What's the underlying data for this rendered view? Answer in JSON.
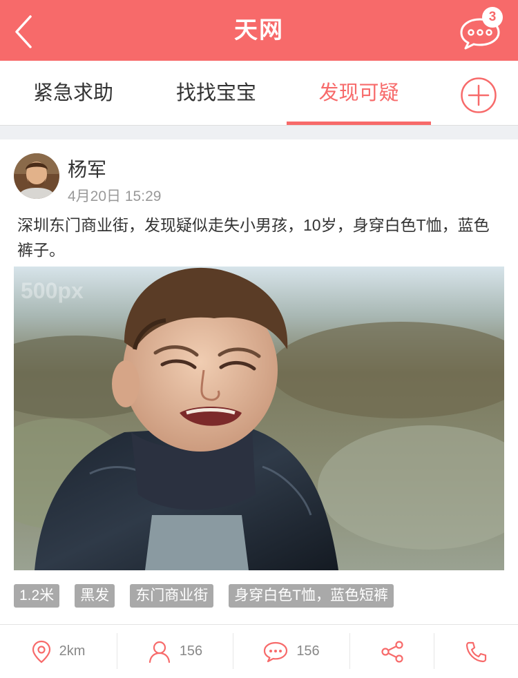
{
  "theme": {
    "accent": "#f76a6a",
    "tag_bg": "#a9a9a9"
  },
  "header": {
    "title": "天网",
    "back_icon": "chevron-left-icon",
    "message_icon": "chat-bubble-icon",
    "message_badge": "3"
  },
  "tabs": [
    {
      "label": "紧急求助",
      "active": false
    },
    {
      "label": "找找宝宝",
      "active": false
    },
    {
      "label": "发现可疑",
      "active": true
    }
  ],
  "tab_add_icon": "plus-circle-icon",
  "post": {
    "username": "杨军",
    "time": "4月20日 15:29",
    "content": "深圳东门商业街，发现疑似走失小男孩，10岁，身穿白色T恤，蓝色裤子。",
    "photo_watermark": "500px",
    "tags": [
      "1.2米",
      "黑发",
      "东门商业街",
      "身穿白色T恤，蓝色短裤"
    ]
  },
  "actions": {
    "distance": "2km",
    "followers": "156",
    "comments": "156"
  }
}
